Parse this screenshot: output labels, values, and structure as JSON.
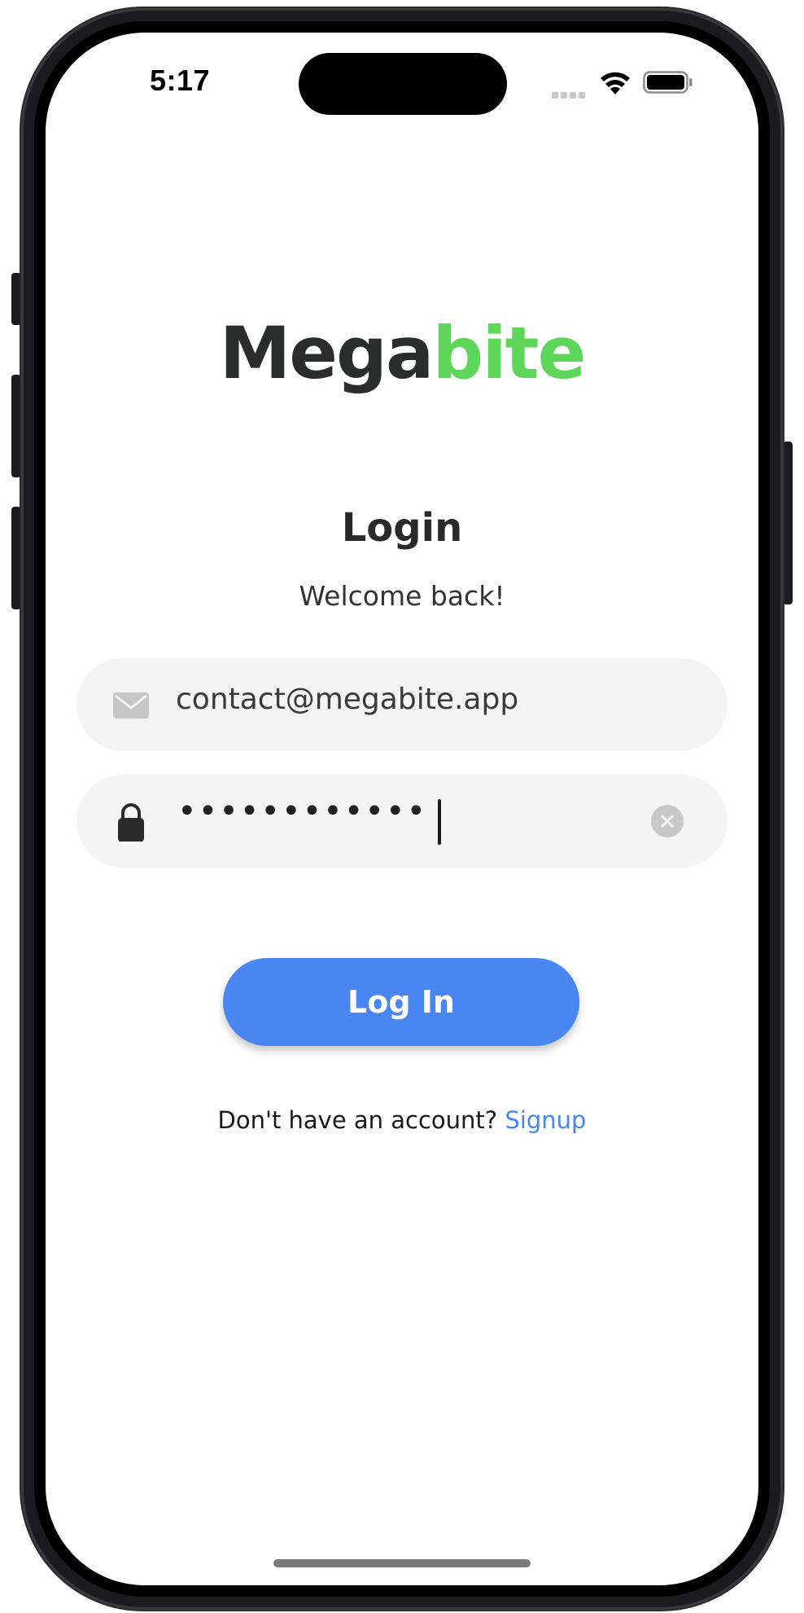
{
  "status_bar": {
    "time": "5:17"
  },
  "brand": {
    "part1": "Mega",
    "part2": "bite",
    "color_dark": "#2b2c2c",
    "color_accent": "#5ed65a"
  },
  "screen": {
    "title": "Login",
    "subtitle": "Welcome back!"
  },
  "form": {
    "email": {
      "icon": "envelope-icon",
      "value": "contact@megabite.app"
    },
    "password": {
      "icon": "lock-icon",
      "masked_value": "••••••••••••",
      "clear_icon": "clear-circle-icon"
    },
    "submit_label": "Log In"
  },
  "footer": {
    "prompt": "Don't have an account?",
    "link_label": "Signup"
  },
  "colors": {
    "primary": "#4a86f2",
    "field_bg": "#f4f4f4"
  }
}
